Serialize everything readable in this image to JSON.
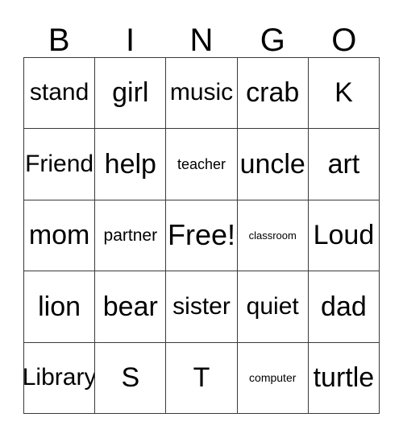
{
  "card": {
    "header_letters": [
      "B",
      "I",
      "N",
      "G",
      "O"
    ],
    "rows": [
      [
        {
          "text": "stand",
          "size": "fs-md"
        },
        {
          "text": "girl",
          "size": "fs-lg"
        },
        {
          "text": "music",
          "size": "fs-md"
        },
        {
          "text": "crab",
          "size": "fs-lg"
        },
        {
          "text": "K",
          "size": "fs-lg"
        }
      ],
      [
        {
          "text": "Friend",
          "size": "fs-md"
        },
        {
          "text": "help",
          "size": "fs-lg"
        },
        {
          "text": "teacher",
          "size": "fs-xs"
        },
        {
          "text": "uncle",
          "size": "fs-lg"
        },
        {
          "text": "art",
          "size": "fs-lg"
        }
      ],
      [
        {
          "text": "mom",
          "size": "fs-lg"
        },
        {
          "text": "partner",
          "size": "fs-sm"
        },
        {
          "text": "Free!",
          "size": "fs-xl"
        },
        {
          "text": "classroom",
          "size": "fs-tiny"
        },
        {
          "text": "Loud",
          "size": "fs-lg"
        }
      ],
      [
        {
          "text": "lion",
          "size": "fs-lg"
        },
        {
          "text": "bear",
          "size": "fs-lg"
        },
        {
          "text": "sister",
          "size": "fs-md"
        },
        {
          "text": "quiet",
          "size": "fs-md"
        },
        {
          "text": "dad",
          "size": "fs-lg"
        }
      ],
      [
        {
          "text": "Library",
          "size": "fs-md"
        },
        {
          "text": "S",
          "size": "fs-lg"
        },
        {
          "text": "T",
          "size": "fs-lg"
        },
        {
          "text": "computer",
          "size": "fs-xxs"
        },
        {
          "text": "turtle",
          "size": "fs-lg"
        }
      ]
    ],
    "colors": {
      "text": "#000000",
      "border": "#3a3a3a",
      "background": "#ffffff"
    }
  }
}
